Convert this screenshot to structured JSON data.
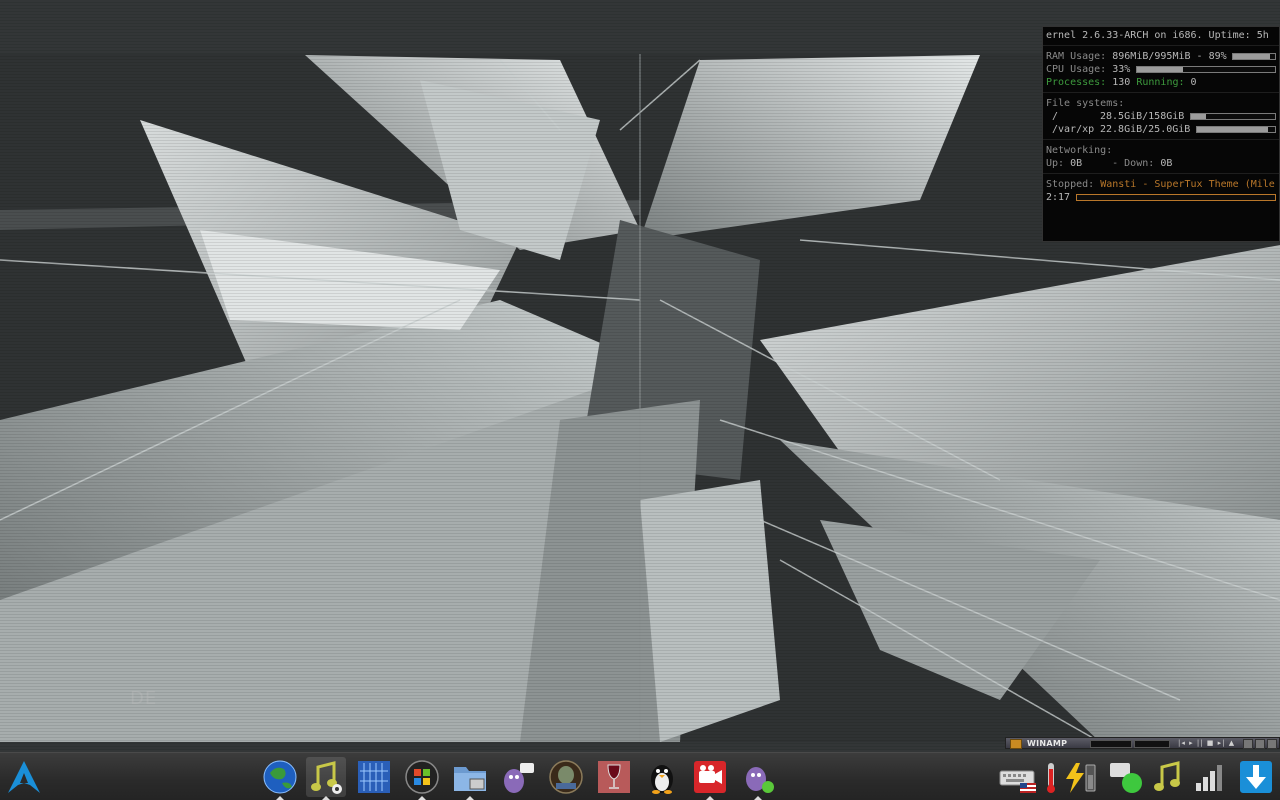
{
  "conky": {
    "kernel_line": "ernel 2.6.33-ARCH on i686. Uptime: 5h",
    "ram_label": "RAM Usage:",
    "ram_value": "896MiB/995MiB - 89%",
    "ram_percent": 89,
    "cpu_label": "CPU Usage:",
    "cpu_value": "33%",
    "cpu_percent": 33,
    "processes_label": "Processes:",
    "processes_value": "130",
    "running_label": "Running:",
    "running_value": "0",
    "fs_label": "File systems:",
    "fs_root_mount": "/",
    "fs_root_value": "28.5GiB/158GiB",
    "fs_root_percent": 18,
    "fs_xp_mount": "/var/xp",
    "fs_xp_value": "22.8GiB/25.0GiB",
    "fs_xp_percent": 91,
    "net_label": "Networking:",
    "up_label": "Up:",
    "up_value": "0B",
    "down_label": "- Down:",
    "down_value": "0B",
    "player_status": "Stopped:",
    "player_track": "Wansti - SuperTux Theme (Mile",
    "player_time": "2:17",
    "player_percent": 0
  },
  "winamp": {
    "title": "WINAMP",
    "controls": "|◂ ▸ || ■ ▸| ▲",
    "accent": "#c88a22"
  },
  "taskbar": {
    "launcher": {
      "icon": "arch-linux-logo-icon"
    },
    "apps": [
      {
        "name": "web-browser-icon"
      },
      {
        "name": "music-player-icon",
        "active": true
      },
      {
        "name": "file-cabinet-icon"
      },
      {
        "name": "windows-logo-icon"
      },
      {
        "name": "file-manager-icon"
      },
      {
        "name": "pidgin-chat-icon"
      },
      {
        "name": "warcraft-game-icon"
      },
      {
        "name": "wine-glass-icon"
      },
      {
        "name": "tux-penguin-icon"
      },
      {
        "name": "video-recorder-icon"
      },
      {
        "name": "pidgin-online-icon"
      }
    ],
    "tray": [
      {
        "name": "keyboard-layout-us-icon"
      },
      {
        "name": "thermometer-icon"
      },
      {
        "name": "power-battery-icon"
      },
      {
        "name": "notification-online-icon"
      },
      {
        "name": "music-note-tray-icon"
      },
      {
        "name": "signal-strength-icon"
      },
      {
        "name": "download-arrow-icon"
      }
    ],
    "accent": "#1a8fd8"
  },
  "wallpaper": {
    "watermark": "DE"
  }
}
